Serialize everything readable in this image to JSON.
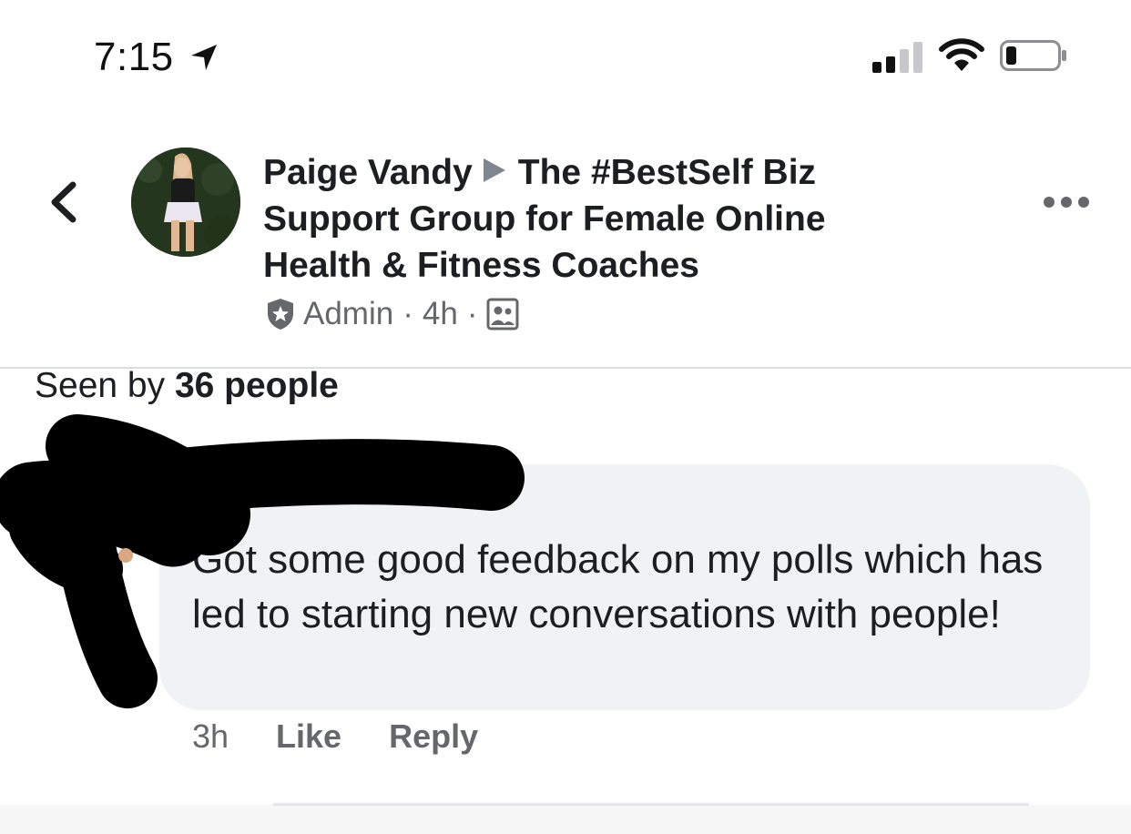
{
  "status_bar": {
    "time": "7:15",
    "icons": [
      "location-arrow-icon",
      "cellular-signal-icon",
      "wifi-icon",
      "battery-icon"
    ]
  },
  "post": {
    "author": "Paige Vandy",
    "group_name": "The #BestSelf Biz Support Group for Female Online Health & Fitness Coaches",
    "role": "Admin",
    "separator": "·",
    "time_ago": "4h",
    "audience_icon": "group-members-icon"
  },
  "seen_by": {
    "prefix": "Seen by",
    "count_text": "36 people"
  },
  "comment": {
    "author": "",
    "text": "Got some good feedback on my polls which has led to starting new conversations with people!",
    "time": "3h",
    "like_label": "Like",
    "reply_label": "Reply"
  },
  "colors": {
    "text_primary": "#1c1e21",
    "text_secondary": "#65676b",
    "bubble_bg": "#f0f2f5",
    "divider": "#dadde1"
  }
}
